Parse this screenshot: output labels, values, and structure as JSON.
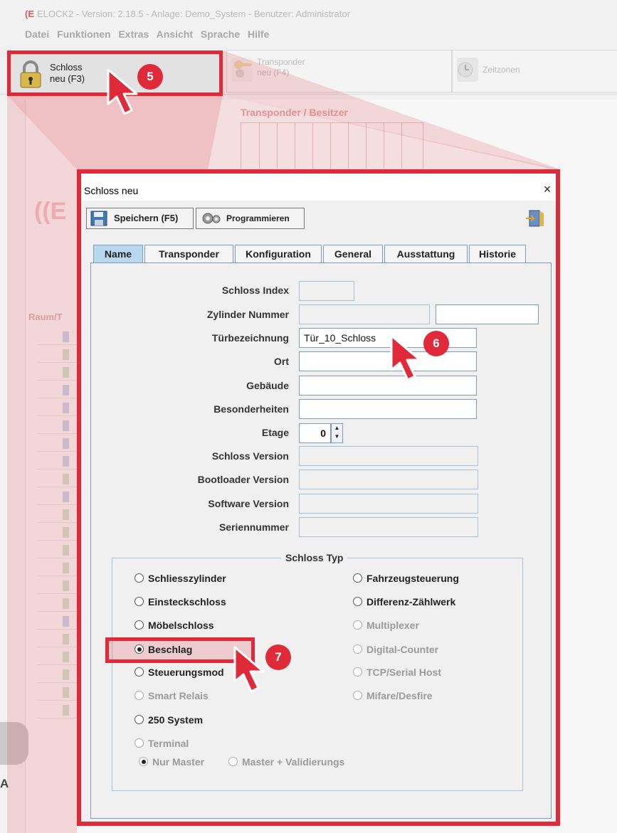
{
  "app": {
    "title": "ELOCK2 - Version: 2.18.5 - Anlage: Demo_System - Benutzer: Administrator",
    "logo_mark": "(E",
    "menu": [
      "Datei",
      "Funktionen",
      "Extras",
      "Ansicht",
      "Sprache",
      "Hilfe"
    ],
    "toolbar": {
      "schloss_line1": "Schloss",
      "schloss_line2": "neu (F3)",
      "transponder_line1": "Transponder",
      "transponder_line2": "neu (F4)",
      "zeitzonen": "Zeitzonen"
    },
    "tp_header": "Transponder / Besitzer",
    "raum_header": "Raum/T",
    "side_letter": "A"
  },
  "markers": {
    "m5": "5",
    "m6": "6",
    "m7": "7"
  },
  "colors": {
    "highlight": "#e02a3a",
    "active_tab": "#b8d8f0",
    "field_border": "#7f9db9"
  },
  "dialog": {
    "title": "Schloss neu",
    "close": "×",
    "save_label": "Speichern (F5)",
    "program_label": "Programmieren",
    "tabs": [
      {
        "label": "Name",
        "active": true
      },
      {
        "label": "Transponder",
        "active": false
      },
      {
        "label": "Konfiguration",
        "active": false
      },
      {
        "label": "General",
        "active": false
      },
      {
        "label": "Ausstattung",
        "active": false
      },
      {
        "label": "Historie",
        "active": false
      }
    ],
    "fields": {
      "schloss_index": {
        "label": "Schloss Index",
        "value": ""
      },
      "zylinder_nummer": {
        "label": "Zylinder Nummer",
        "value": "",
        "value2": ""
      },
      "tuerbezeichnung": {
        "label": "Türbezeichnung",
        "value": "Tür_10_Schloss"
      },
      "ort": {
        "label": "Ort",
        "value": ""
      },
      "gebaeude": {
        "label": "Gebäude",
        "value": ""
      },
      "besonderheiten": {
        "label": "Besonderheiten",
        "value": ""
      },
      "etage": {
        "label": "Etage",
        "value": "0"
      },
      "schloss_version": {
        "label": "Schloss Version",
        "value": ""
      },
      "bootloader_version": {
        "label": "Bootloader Version",
        "value": ""
      },
      "software_version": {
        "label": "Software Version",
        "value": ""
      },
      "seriennummer": {
        "label": "Seriennummer",
        "value": ""
      }
    },
    "schloss_typ": {
      "legend": "Schloss Typ",
      "left": [
        {
          "label": "Schliesszylinder",
          "selected": false,
          "enabled": true
        },
        {
          "label": "Einsteckschloss",
          "selected": false,
          "enabled": true
        },
        {
          "label": "Möbelschloss",
          "selected": false,
          "enabled": true
        },
        {
          "label": "Beschlag",
          "selected": true,
          "enabled": true
        },
        {
          "label": "Steuerungsmod",
          "selected": false,
          "enabled": true
        },
        {
          "label": "Smart Relais",
          "selected": false,
          "enabled": false
        },
        {
          "label": "250 System",
          "selected": false,
          "enabled": true
        },
        {
          "label": "Terminal",
          "selected": false,
          "enabled": false
        }
      ],
      "right": [
        {
          "label": "Fahrzeugsteuerung",
          "selected": false,
          "enabled": true
        },
        {
          "label": "Differenz-Zählwerk",
          "selected": false,
          "enabled": true
        },
        {
          "label": "Multiplexer",
          "selected": false,
          "enabled": false
        },
        {
          "label": "Digital-Counter",
          "selected": false,
          "enabled": false
        },
        {
          "label": "TCP/Serial Host",
          "selected": false,
          "enabled": false
        },
        {
          "label": "Mifare/Desfire",
          "selected": false,
          "enabled": false
        }
      ],
      "terminal_options": [
        {
          "label": "Nur Master",
          "selected": true
        },
        {
          "label": "Master + Validierungs",
          "selected": false
        }
      ]
    }
  }
}
